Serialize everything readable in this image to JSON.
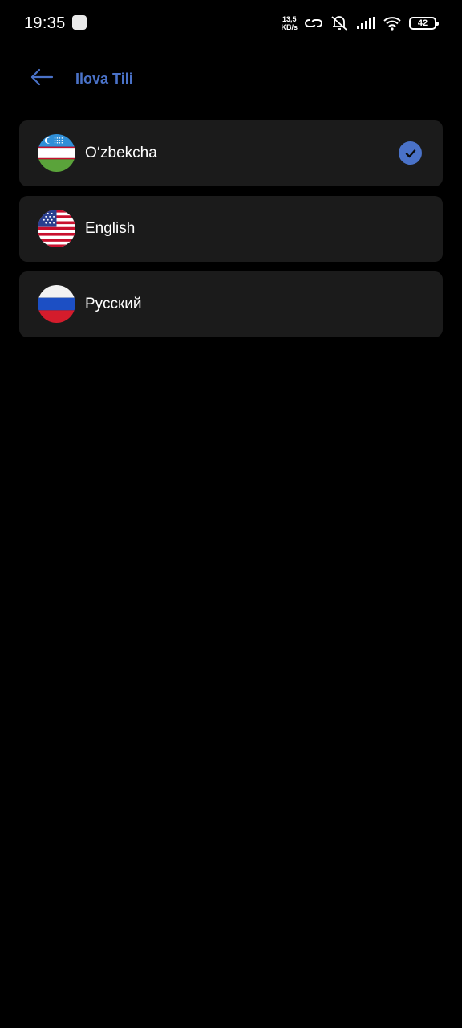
{
  "status_bar": {
    "time": "19:35",
    "net_speed_value": "13,5",
    "net_speed_unit": "KB/s",
    "battery": "42",
    "icons": [
      "app-notification-icon",
      "link-icon",
      "vibrate-off-icon",
      "signal-icon",
      "wifi-icon",
      "battery-icon"
    ]
  },
  "header": {
    "back_icon": "arrow-left-icon",
    "title": "Ilova Tili"
  },
  "languages": [
    {
      "label": "O‘zbekcha",
      "flag": "uzbekistan-flag-icon",
      "selected": true
    },
    {
      "label": "English",
      "flag": "usa-flag-icon",
      "selected": false
    },
    {
      "label": "Русский",
      "flag": "russia-flag-icon",
      "selected": false
    }
  ],
  "colors": {
    "accent": "#4a72c8",
    "background": "#000000",
    "card": "#1b1b1b",
    "text": "#ffffff"
  }
}
